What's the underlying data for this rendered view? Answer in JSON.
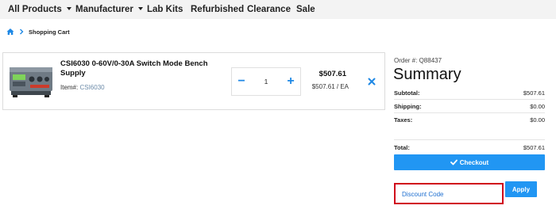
{
  "nav": {
    "all_products": "All Products",
    "manufacturer": "Manufacturer",
    "lab_kits": "Lab Kits",
    "refurbished": "Refurbished",
    "clearance": "Clearance",
    "sale": "Sale"
  },
  "breadcrumb": {
    "current": "Shopping Cart"
  },
  "cart": {
    "item": {
      "name": "CSI6030 0-60V/0-30A Switch Mode Bench Supply",
      "item_label": "Item#:",
      "sku": "CSI6030",
      "quantity": "1",
      "price": "$507.61",
      "unit_price": "$507.61 / EA"
    }
  },
  "summary": {
    "order_no": "Order #: Q88437",
    "title": "Summary",
    "subtotal_label": "Subtotal:",
    "subtotal": "$507.61",
    "shipping_label": "Shipping:",
    "shipping": "$0.00",
    "taxes_label": "Taxes:",
    "taxes": "$0.00",
    "total_label": "Total:",
    "total": "$507.61",
    "checkout_label": "Checkout",
    "discount_placeholder": "Discount Code",
    "apply_label": "Apply"
  },
  "colors": {
    "accent": "#2196f3",
    "highlight_border": "#d0021b",
    "nav_bg": "#f3f3f3"
  }
}
